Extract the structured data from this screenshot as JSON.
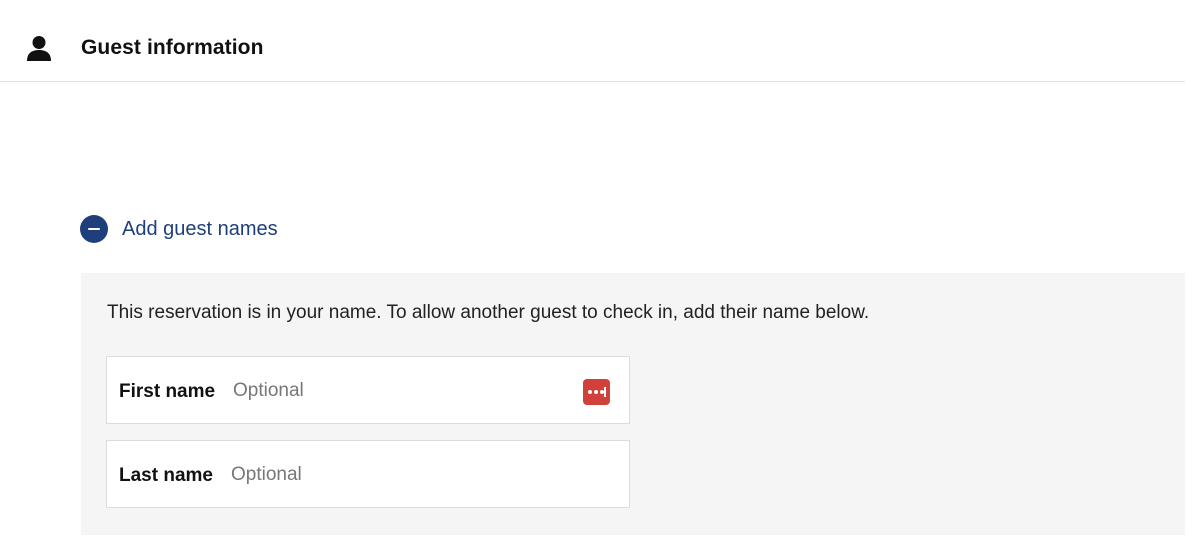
{
  "header": {
    "icon": "person-icon",
    "title": "Guest information"
  },
  "guest_names_toggle": {
    "icon": "minus-circle-icon",
    "label": "Add guest names",
    "accent_color": "#1e3f7c"
  },
  "guest_panel": {
    "description": "This reservation is in your name. To allow another guest to check in, add their name below.",
    "fields": [
      {
        "label": "First name",
        "placeholder": "Optional",
        "value": ""
      },
      {
        "label": "Last name",
        "placeholder": "Optional",
        "value": ""
      }
    ],
    "password_manager_icon": "password-manager-icon",
    "password_manager_color": "#d0413b"
  }
}
